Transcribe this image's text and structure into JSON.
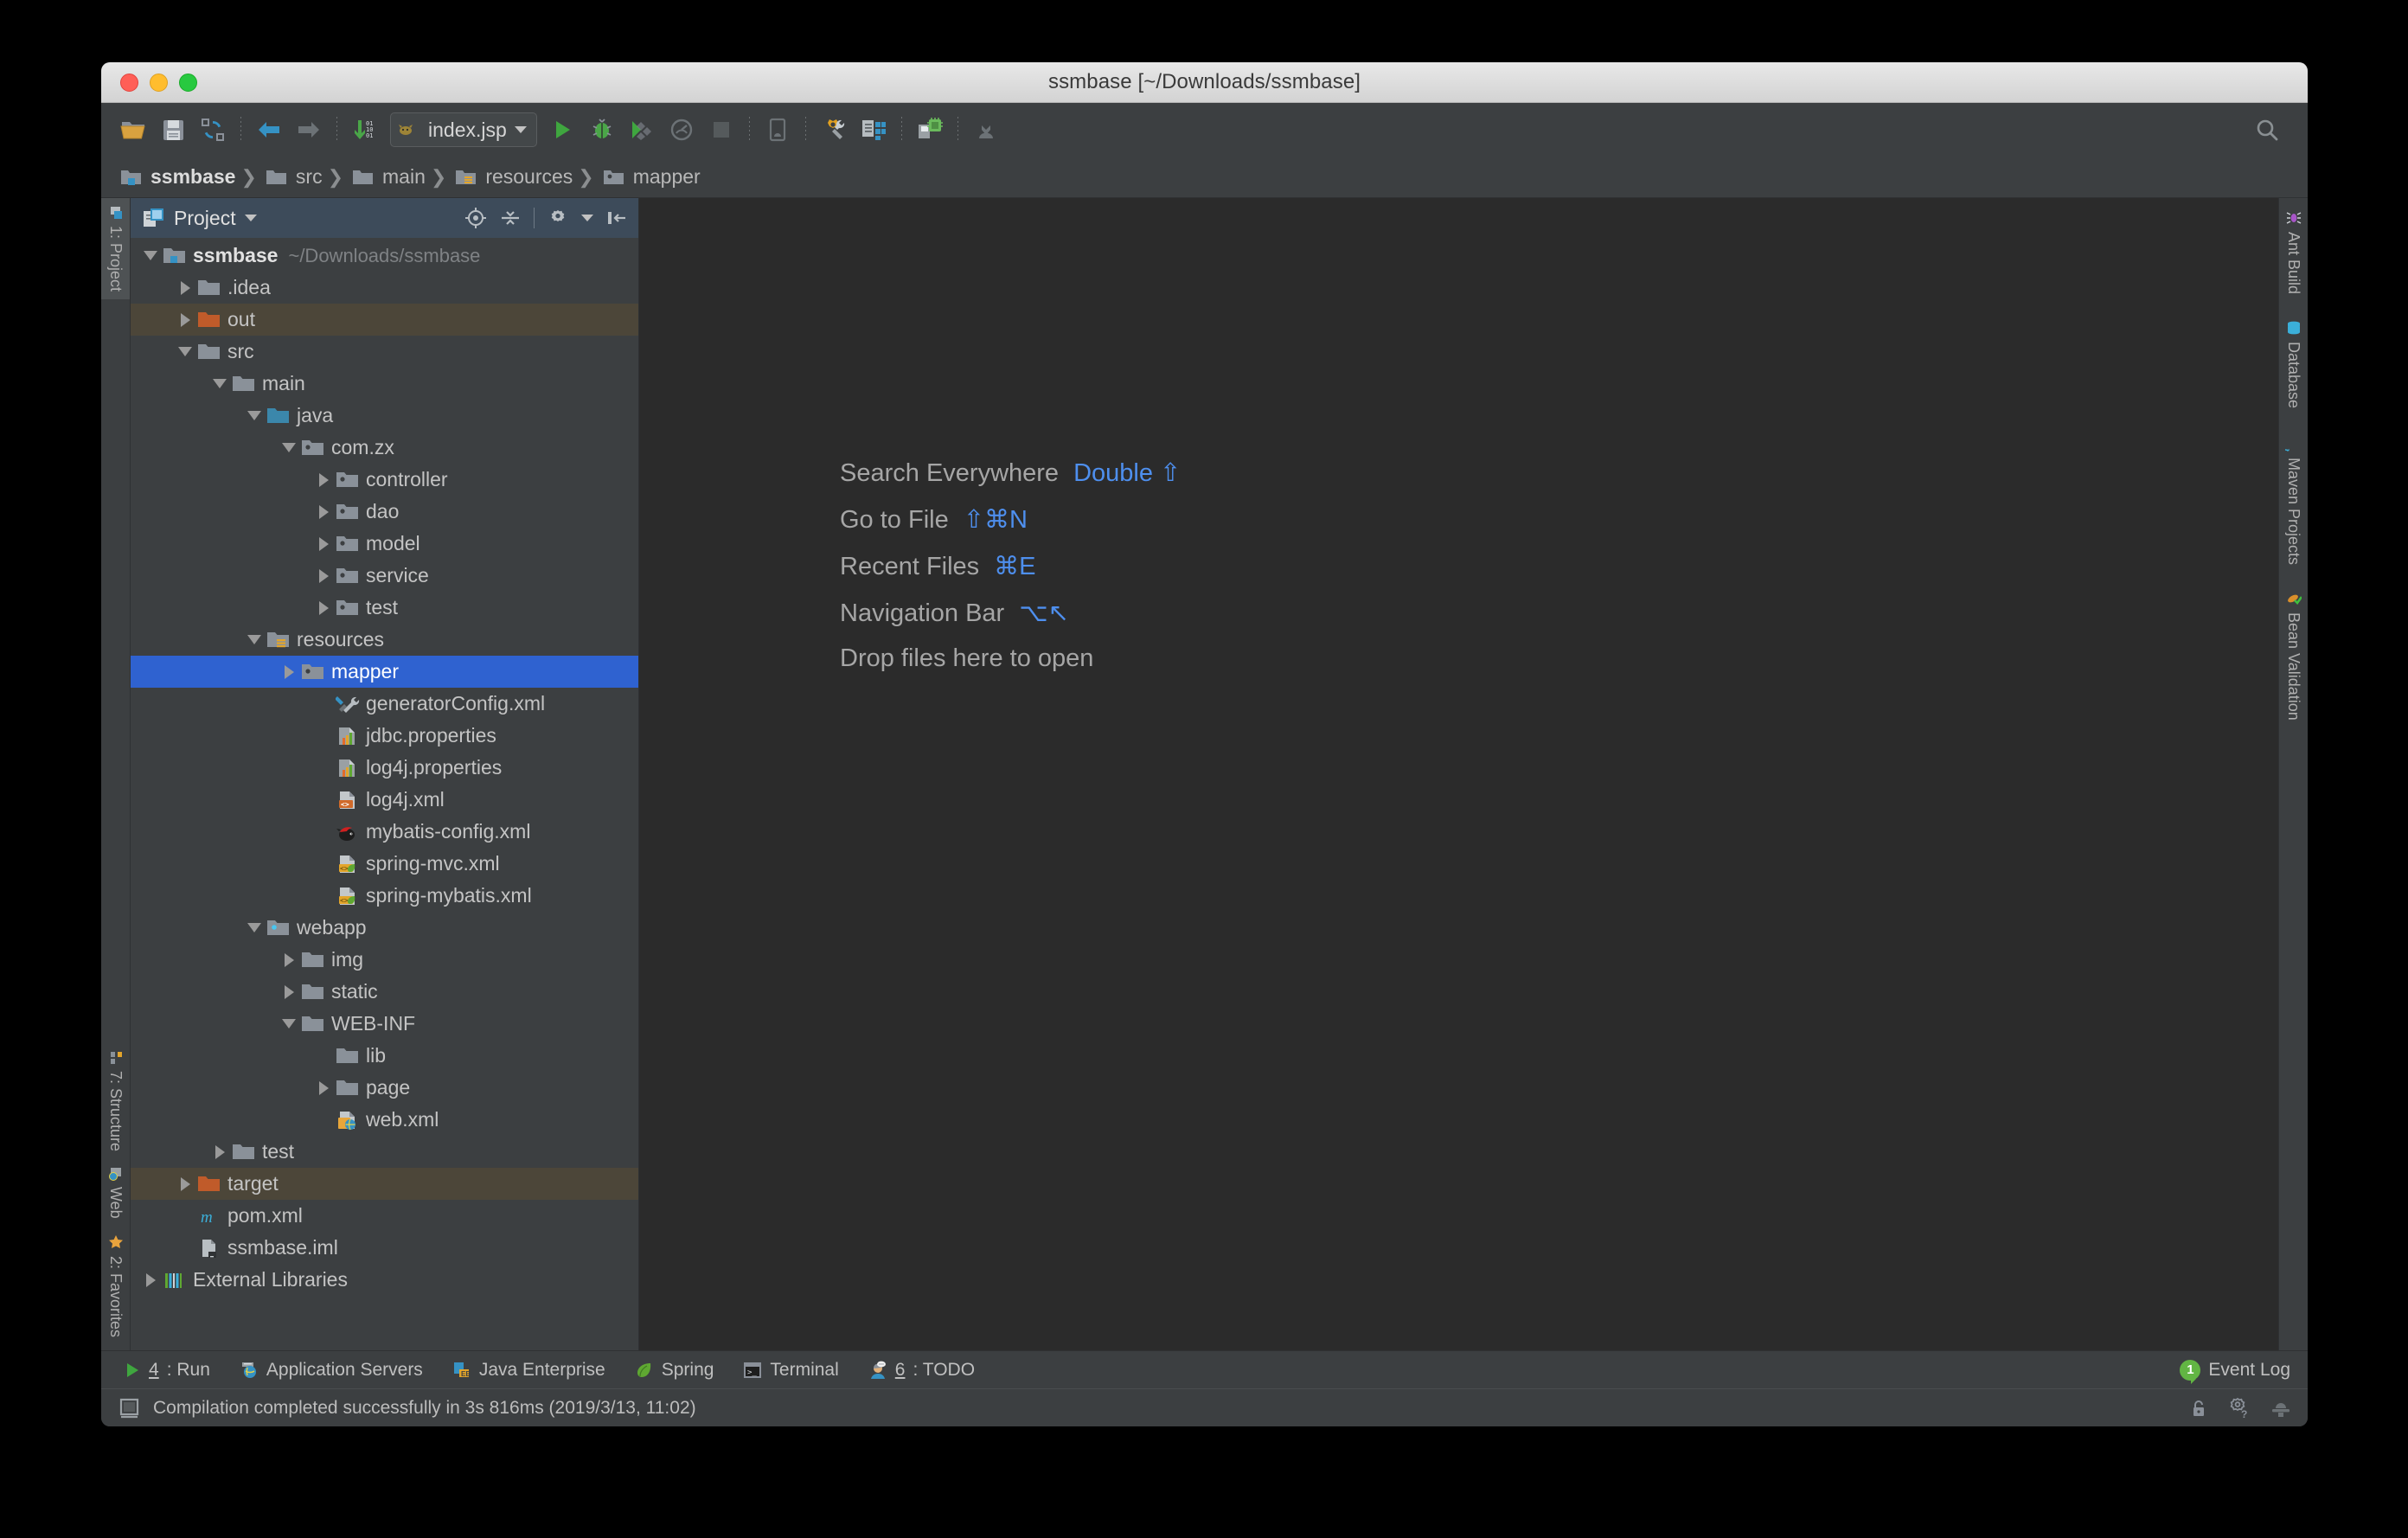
{
  "window": {
    "title": "ssmbase [~/Downloads/ssmbase]",
    "traffic": {
      "close": "close-button",
      "minimize": "minimize-button",
      "zoom": "zoom-button"
    }
  },
  "toolbar": {
    "run_config": "index.jsp",
    "icons": [
      "open-folder-icon",
      "save-all-icon",
      "sync-icon",
      "back-icon",
      "forward-icon",
      "compile-icon"
    ],
    "right_icons": [
      "run-icon",
      "debug-icon",
      "run-coverage-icon",
      "profile-icon",
      "stop-icon",
      "android-device-icon",
      "settings-wrench-icon",
      "project-structure-icon",
      "avd-manager-icon",
      "sdk-manager-icon"
    ],
    "search_icon": "search-icon"
  },
  "breadcrumb": [
    {
      "label": "ssmbase",
      "icon": "module-folder-icon"
    },
    {
      "label": "src",
      "icon": "folder-icon"
    },
    {
      "label": "main",
      "icon": "folder-icon"
    },
    {
      "label": "resources",
      "icon": "resources-folder-icon"
    },
    {
      "label": "mapper",
      "icon": "package-folder-icon"
    }
  ],
  "left_stripe": {
    "top": [
      {
        "label": "1: Project",
        "icon": "project-icon",
        "active": true
      }
    ],
    "bottom": [
      {
        "label": "7: Structure",
        "icon": "structure-icon"
      },
      {
        "label": "Web",
        "icon": "web-icon"
      },
      {
        "label": "2: Favorites",
        "icon": "favorites-star-icon"
      }
    ]
  },
  "right_stripe": [
    {
      "label": "Ant Build",
      "icon": "ant-icon"
    },
    {
      "label": "Database",
      "icon": "database-icon"
    },
    {
      "label": "Maven Projects",
      "icon": "maven-icon"
    },
    {
      "label": "Bean Validation",
      "icon": "bean-validation-icon"
    }
  ],
  "project_panel": {
    "title": "Project",
    "tools": [
      "locate-target-icon",
      "collapse-all-icon",
      "settings-gear-icon",
      "hide-panel-icon"
    ]
  },
  "tree": [
    {
      "depth": 0,
      "twisty": "open",
      "icon": "module-folder-icon",
      "label": "ssmbase",
      "bold": true,
      "sub": "~/Downloads/ssmbase"
    },
    {
      "depth": 1,
      "twisty": "closed",
      "icon": "folder-icon",
      "label": ".idea"
    },
    {
      "depth": 1,
      "twisty": "closed",
      "icon": "excluded-folder-icon",
      "label": "out",
      "state": "excluded"
    },
    {
      "depth": 1,
      "twisty": "open",
      "icon": "folder-icon",
      "label": "src"
    },
    {
      "depth": 2,
      "twisty": "open",
      "icon": "folder-icon",
      "label": "main"
    },
    {
      "depth": 3,
      "twisty": "open",
      "icon": "source-folder-icon",
      "label": "java"
    },
    {
      "depth": 4,
      "twisty": "open",
      "icon": "package-folder-icon",
      "label": "com.zx"
    },
    {
      "depth": 5,
      "twisty": "closed",
      "icon": "package-folder-icon",
      "label": "controller"
    },
    {
      "depth": 5,
      "twisty": "closed",
      "icon": "package-folder-icon",
      "label": "dao"
    },
    {
      "depth": 5,
      "twisty": "closed",
      "icon": "package-folder-icon",
      "label": "model"
    },
    {
      "depth": 5,
      "twisty": "closed",
      "icon": "package-folder-icon",
      "label": "service"
    },
    {
      "depth": 5,
      "twisty": "closed",
      "icon": "package-folder-icon",
      "label": "test"
    },
    {
      "depth": 3,
      "twisty": "open",
      "icon": "resources-folder-icon",
      "label": "resources"
    },
    {
      "depth": 4,
      "twisty": "closed",
      "icon": "package-folder-icon",
      "label": "mapper",
      "state": "selected"
    },
    {
      "depth": 5,
      "twisty": "none",
      "icon": "generator-config-icon",
      "label": "generatorConfig.xml"
    },
    {
      "depth": 5,
      "twisty": "none",
      "icon": "properties-file-icon",
      "label": "jdbc.properties"
    },
    {
      "depth": 5,
      "twisty": "none",
      "icon": "properties-file-icon",
      "label": "log4j.properties"
    },
    {
      "depth": 5,
      "twisty": "none",
      "icon": "xml-file-icon",
      "label": "log4j.xml"
    },
    {
      "depth": 5,
      "twisty": "none",
      "icon": "mybatis-file-icon",
      "label": "mybatis-config.xml"
    },
    {
      "depth": 5,
      "twisty": "none",
      "icon": "spring-xml-file-icon",
      "label": "spring-mvc.xml"
    },
    {
      "depth": 5,
      "twisty": "none",
      "icon": "spring-xml-file-icon",
      "label": "spring-mybatis.xml"
    },
    {
      "depth": 3,
      "twisty": "open",
      "icon": "webapp-folder-icon",
      "label": "webapp"
    },
    {
      "depth": 4,
      "twisty": "closed",
      "icon": "folder-icon",
      "label": "img"
    },
    {
      "depth": 4,
      "twisty": "closed",
      "icon": "folder-icon",
      "label": "static"
    },
    {
      "depth": 4,
      "twisty": "open",
      "icon": "folder-icon",
      "label": "WEB-INF"
    },
    {
      "depth": 5,
      "twisty": "none",
      "icon": "folder-icon",
      "label": "lib"
    },
    {
      "depth": 5,
      "twisty": "closed",
      "icon": "folder-icon",
      "label": "page"
    },
    {
      "depth": 5,
      "twisty": "none",
      "icon": "web-xml-file-icon",
      "label": "web.xml"
    },
    {
      "depth": 2,
      "twisty": "closed",
      "icon": "folder-icon",
      "label": "test"
    },
    {
      "depth": 1,
      "twisty": "closed",
      "icon": "excluded-folder-icon",
      "label": "target",
      "state": "excluded"
    },
    {
      "depth": 1,
      "twisty": "none",
      "icon": "maven-pom-icon",
      "label": "pom.xml"
    },
    {
      "depth": 1,
      "twisty": "none",
      "icon": "iml-file-icon",
      "label": "ssmbase.iml"
    },
    {
      "depth": 0,
      "twisty": "closed",
      "icon": "external-libraries-icon",
      "label": "External Libraries"
    }
  ],
  "editor_hints": [
    {
      "label": "Search Everywhere",
      "keys": "Double ⇧"
    },
    {
      "label": "Go to File",
      "keys": "⇧⌘N"
    },
    {
      "label": "Recent Files",
      "keys": "⌘E"
    },
    {
      "label": "Navigation Bar",
      "keys": "⌥↖"
    },
    {
      "label": "Drop files here to open",
      "keys": ""
    }
  ],
  "bottom_bar": {
    "items": [
      {
        "num": "4",
        "label": ": Run",
        "icon": "run-green-icon"
      },
      {
        "num": "",
        "label": "Application Servers",
        "icon": "app-servers-icon"
      },
      {
        "num": "",
        "label": "Java Enterprise",
        "icon": "java-ee-icon"
      },
      {
        "num": "",
        "label": "Spring",
        "icon": "spring-leaf-icon"
      },
      {
        "num": "",
        "label": "Terminal",
        "icon": "terminal-icon"
      },
      {
        "num": "6",
        "label": ": TODO",
        "icon": "todo-icon"
      }
    ],
    "event_log": {
      "label": "Event Log",
      "count": "1",
      "icon": "event-log-icon"
    }
  },
  "status_bar": {
    "message": "Compilation completed successfully in 3s 816ms (2019/3/13, 11:02)",
    "left_icon": "memory-indicator-icon",
    "right_icons": [
      "lock-icon",
      "gear-question-icon",
      "background-tasks-icon"
    ]
  },
  "colors": {
    "accent_blue": "#2f62d0",
    "hint_blue": "#4e8fee",
    "excluded": "#4c4639",
    "panel_bg": "#3c3f41",
    "editor_bg": "#2b2b2b",
    "header_bg": "#3d4b5a"
  }
}
